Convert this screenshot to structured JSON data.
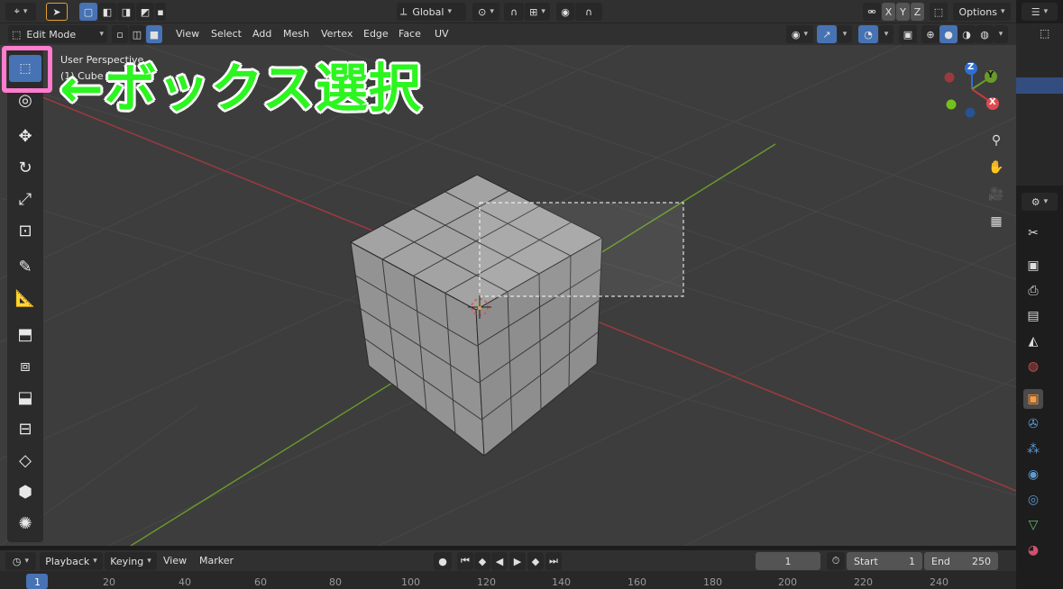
{
  "top_header": {
    "transform_orientation": "Global",
    "options_label": "Options",
    "axis_x": "X",
    "axis_y": "Y",
    "axis_z": "Z"
  },
  "mode_header": {
    "mode": "Edit Mode",
    "menus": [
      "View",
      "Select",
      "Add",
      "Mesh",
      "Vertex",
      "Edge",
      "Face",
      "UV"
    ]
  },
  "viewport": {
    "view_name": "User Perspective",
    "object_label": "(1) Cube",
    "gizmo": {
      "x": "X",
      "y": "Y",
      "z": "Z"
    }
  },
  "annotation": {
    "text": "←ボックス選択",
    "highlight_color": "#ff7ccf",
    "text_color": "#2cf51f"
  },
  "timeline": {
    "menus": [
      "Playback",
      "Keying",
      "View",
      "Marker"
    ],
    "current_frame": "1",
    "start_label": "Start",
    "start_value": "1",
    "end_label": "End",
    "end_value": "250",
    "ruler": [
      "1",
      "20",
      "40",
      "60",
      "80",
      "100",
      "120",
      "140",
      "160",
      "180",
      "200",
      "220",
      "240"
    ]
  },
  "colors": {
    "accent": "#4772b3",
    "x_axis": "#a23a3f",
    "y_axis": "#6a9a2a",
    "z_axis": "#2f6fd3"
  }
}
